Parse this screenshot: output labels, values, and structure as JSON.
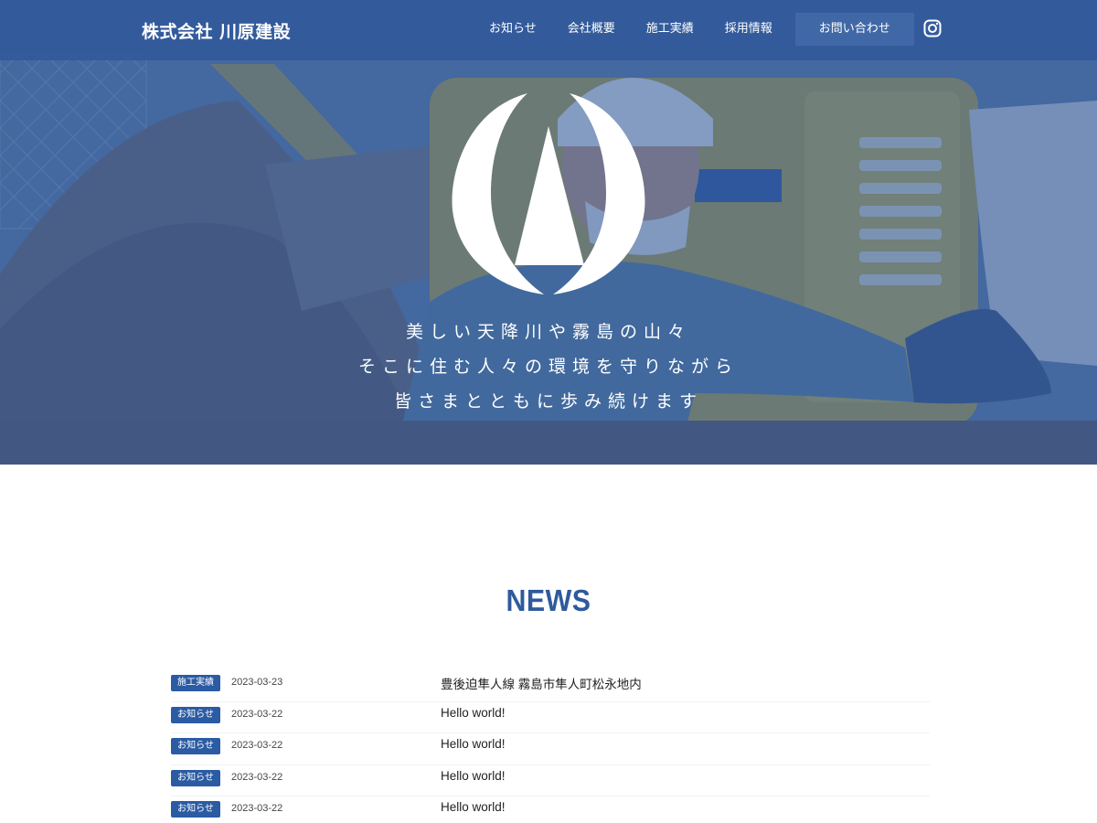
{
  "header": {
    "site_title": "株式会社 川原建設",
    "nav": [
      "お知らせ",
      "会社概要",
      "施工実績",
      "採用情報"
    ],
    "contact_label": "お問い合わせ",
    "instagram_icon": "instagram-icon"
  },
  "hero": {
    "photo": "construction-worker-with-excavator-photo",
    "logo_icon": "kawahara-logo-icon",
    "tagline": [
      "美しい天降川や霧島の山々",
      "そこに住む人々の環境を守りながら",
      "皆さまとともに歩み続けます"
    ],
    "overlay_color": "#2e5696"
  },
  "news": {
    "heading": "NEWS",
    "accent_color": "#2b5ba3",
    "items": [
      {
        "category": "施工実績",
        "date": "2023-03-23",
        "title": "豊後迫隼人線 霧島市隼人町松永地内"
      },
      {
        "category": "お知らせ",
        "date": "2023-03-22",
        "title": "Hello world!"
      },
      {
        "category": "お知らせ",
        "date": "2023-03-22",
        "title": "Hello world!"
      },
      {
        "category": "お知らせ",
        "date": "2023-03-22",
        "title": "Hello world!"
      },
      {
        "category": "お知らせ",
        "date": "2023-03-22",
        "title": "Hello world!"
      }
    ]
  }
}
